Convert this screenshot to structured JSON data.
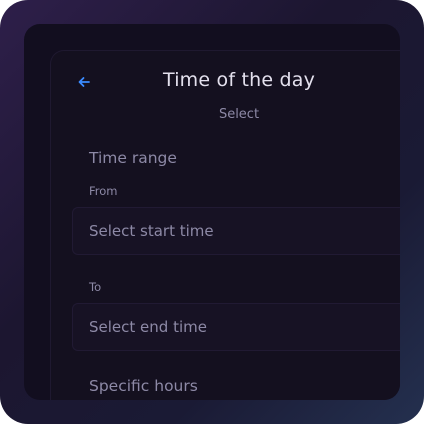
{
  "header": {
    "title": "Time of the day",
    "subtitle": "Select"
  },
  "time_range": {
    "heading": "Time range",
    "from_label": "From",
    "start_placeholder": "Select start time",
    "to_label": "To",
    "end_placeholder": "Select end time"
  },
  "specific_hours": {
    "heading": "Specific hours"
  },
  "icons": {
    "back": "arrow-left-icon",
    "chevron": "chevron-right-icon"
  },
  "colors": {
    "accent": "#3b8bff",
    "text_primary": "#e4e1ee",
    "text_muted": "#8d89a6"
  }
}
